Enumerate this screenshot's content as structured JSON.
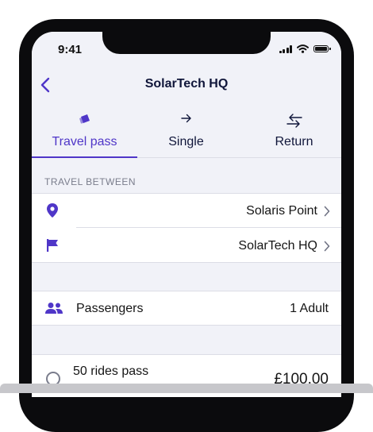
{
  "status_bar": {
    "time": "9:41"
  },
  "header": {
    "title": "SolarTech HQ",
    "back_icon": "chevron-left-icon"
  },
  "tabs": [
    {
      "label": "Travel pass",
      "icon": "ticket-icon",
      "active": true
    },
    {
      "label": "Single",
      "icon": "arrow-right-icon",
      "active": false
    },
    {
      "label": "Return",
      "icon": "swap-arrows-icon",
      "active": false
    }
  ],
  "travel": {
    "section_label": "TRAVEL BETWEEN",
    "origin": {
      "icon": "location-pin-icon",
      "value": "Solaris Point"
    },
    "destination": {
      "icon": "flag-icon",
      "value": "SolarTech HQ"
    }
  },
  "passengers": {
    "icon": "people-icon",
    "label": "Passengers",
    "value": "1 Adult"
  },
  "pass_options": [
    {
      "label": "50 rides pass",
      "price": "£100.00",
      "selected": false
    }
  ],
  "colors": {
    "accent": "#4f36c8",
    "background": "#f1f2f8",
    "text": "#10163a"
  }
}
